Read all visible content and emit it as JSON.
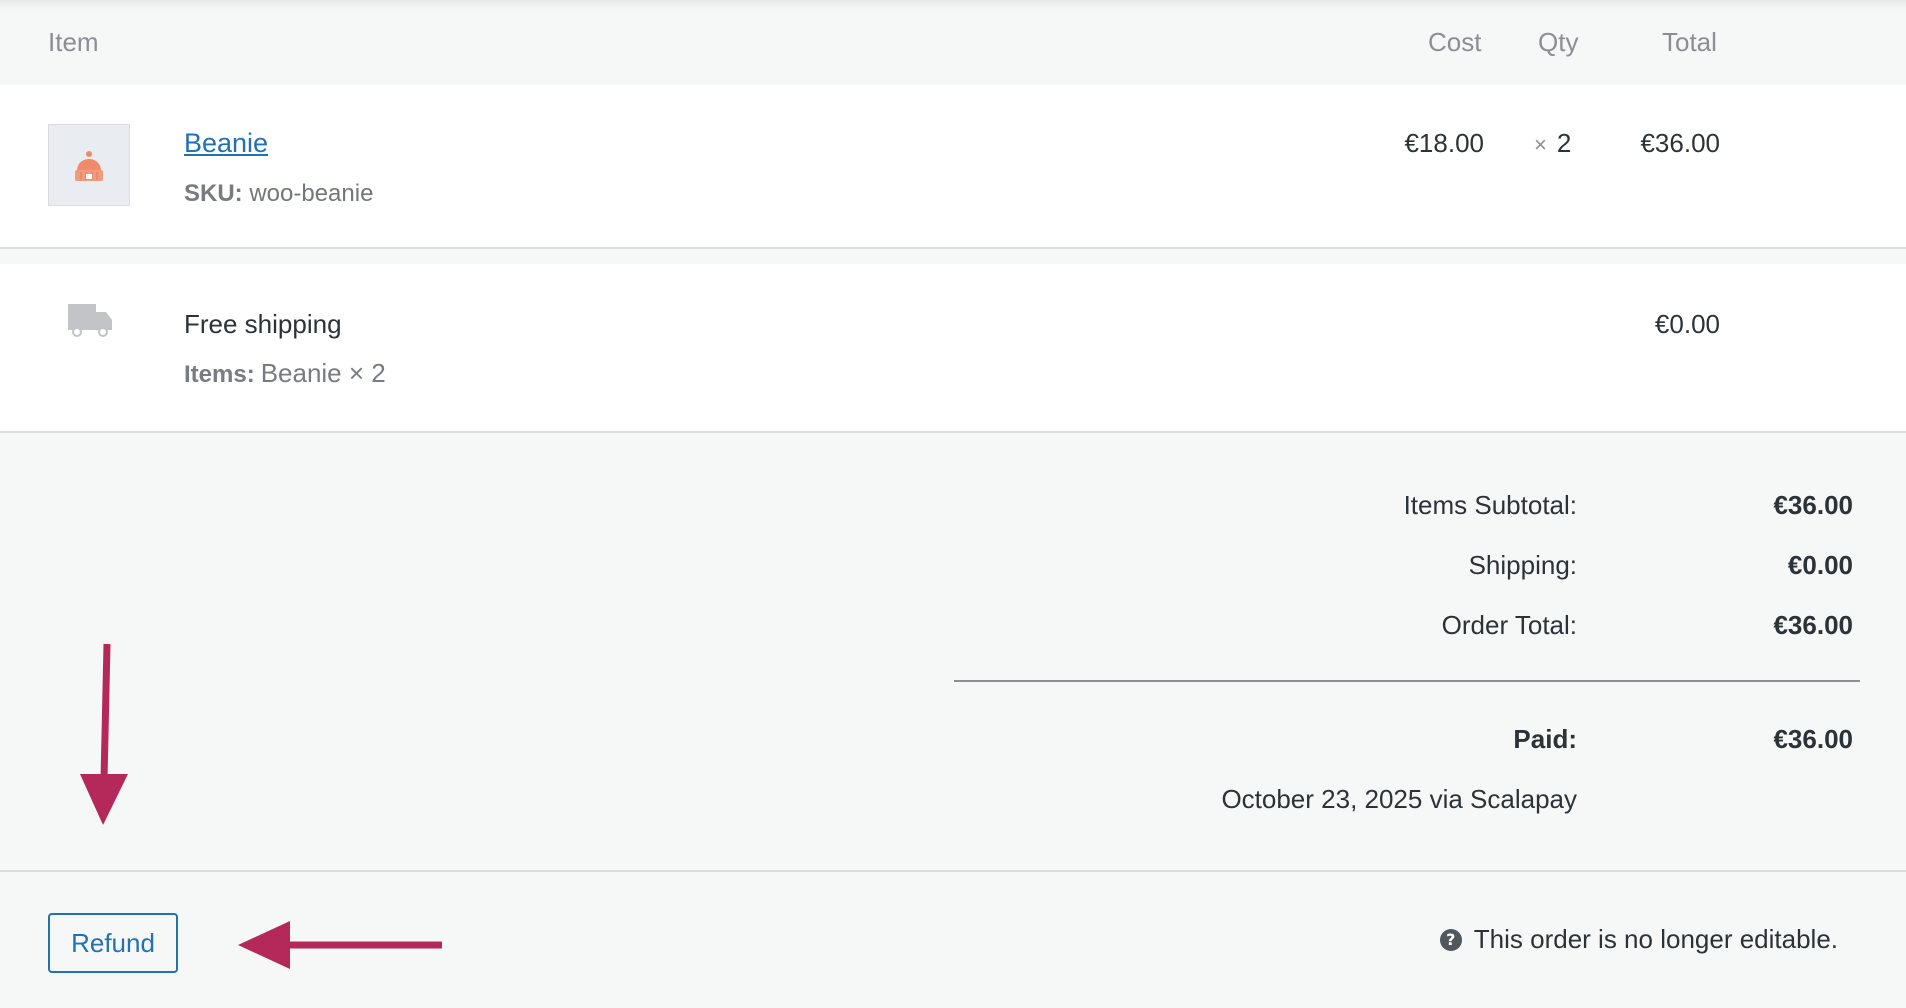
{
  "table": {
    "headers": {
      "item": "Item",
      "cost": "Cost",
      "qty": "Qty",
      "total": "Total"
    }
  },
  "line_item": {
    "name": "Beanie",
    "sku_label": "SKU:",
    "sku_value": "woo-beanie",
    "cost": "€18.00",
    "qty_times": "×",
    "qty": "2",
    "total": "€36.00",
    "thumbnail_icon": "beanie-thumbnail"
  },
  "shipping": {
    "icon": "truck-icon",
    "name": "Free shipping",
    "items_label": "Items:",
    "items_value": "Beanie × 2",
    "total": "€0.00"
  },
  "totals": {
    "items_subtotal_label": "Items Subtotal:",
    "items_subtotal_value": "€36.00",
    "shipping_label": "Shipping:",
    "shipping_value": "€0.00",
    "order_total_label": "Order Total:",
    "order_total_value": "€36.00",
    "paid_label": "Paid:",
    "paid_value": "€36.00",
    "paid_note": "October 23, 2025 via Scalapay"
  },
  "footer": {
    "refund_label": "Refund",
    "notice_text": "This order is no longer editable.",
    "notice_icon": "help-icon"
  },
  "colors": {
    "link": "#2271b1",
    "annotation_arrow": "#b5295a"
  }
}
